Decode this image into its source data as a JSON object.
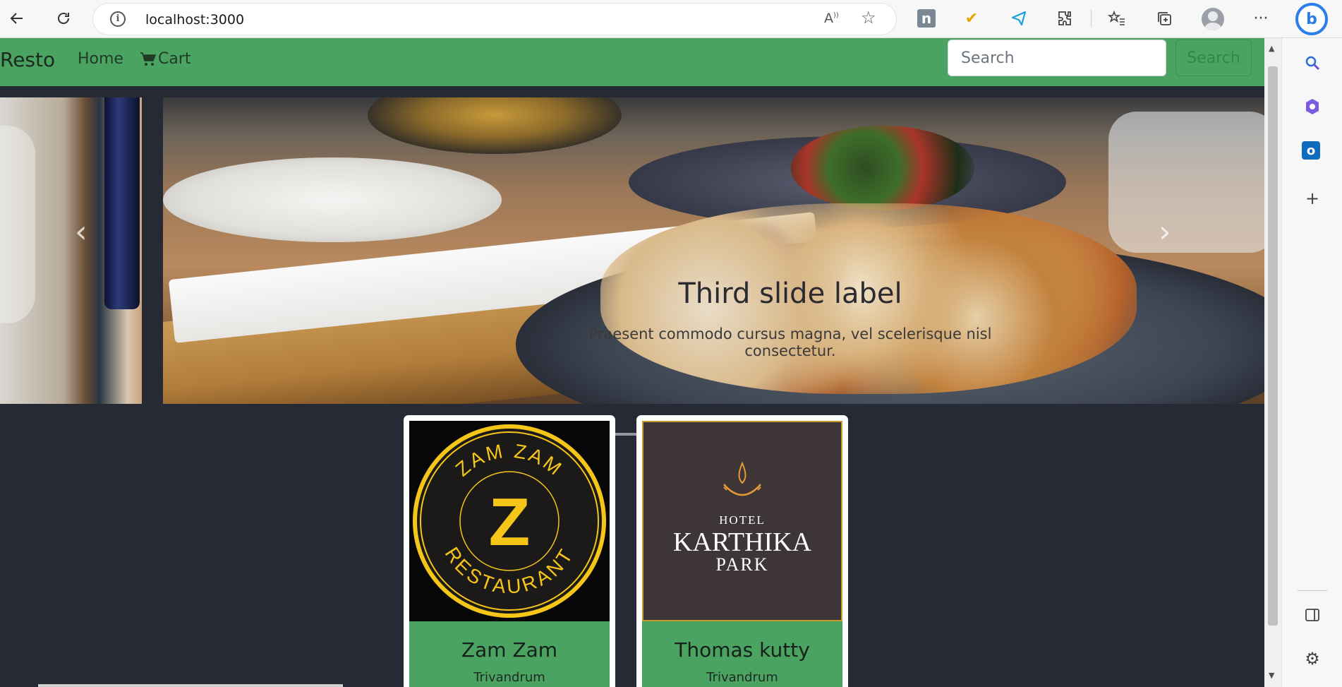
{
  "browser": {
    "url": "localhost:3000"
  },
  "navbar": {
    "brand": "Resto",
    "home": "Home",
    "cart": "Cart",
    "search_placeholder": "Search",
    "search_button": "Search"
  },
  "carousel": {
    "caption_title": "Third slide label",
    "caption_text": "Praesent commodo cursus magna, vel scelerisque nisl consectetur.",
    "indicator_count": 3,
    "active_index": 2
  },
  "cards": [
    {
      "title": "Zam Zam",
      "text": "Trivandrum",
      "logo_top": "ZAM ZAM",
      "logo_bottom": "RESTAURANT",
      "logo_mark": "Z"
    },
    {
      "title": "Thomas kutty",
      "text": "Trivandrum",
      "logo_line1": "HOTEL",
      "logo_line2": "KARTHIKA",
      "logo_line3": "PARK"
    }
  ],
  "colors": {
    "navbar": "#4ba362",
    "page_bg": "#252a34",
    "zamzam_gold": "#f5c518",
    "karthika_bg": "#3e3536"
  }
}
